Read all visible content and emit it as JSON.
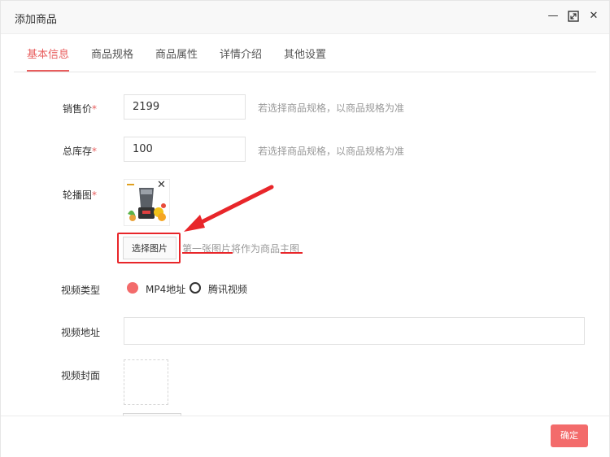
{
  "dialog": {
    "title": "添加商品",
    "controls": {
      "minimize": "—",
      "maximize": "⤢",
      "close": "✕"
    }
  },
  "tabs": [
    {
      "label": "基本信息",
      "active": true
    },
    {
      "label": "商品规格",
      "active": false
    },
    {
      "label": "商品属性",
      "active": false
    },
    {
      "label": "详情介绍",
      "active": false
    },
    {
      "label": "其他设置",
      "active": false
    }
  ],
  "form": {
    "price": {
      "label": "销售价",
      "required_mark": "*",
      "value": "2199",
      "hint": "若选择商品规格，以商品规格为准"
    },
    "stock": {
      "label": "总库存",
      "required_mark": "*",
      "value": "100",
      "hint": "若选择商品规格，以商品规格为准"
    },
    "carousel": {
      "label": "轮播图",
      "required_mark": "*",
      "remove_icon": "✕",
      "select_button": "选择图片",
      "hint": "第一张图片将作为商品主图"
    },
    "video_type": {
      "label": "视频类型",
      "options": [
        {
          "label": "MP4地址",
          "selected": true
        },
        {
          "label": "腾讯视频",
          "selected": false
        }
      ]
    },
    "video_url": {
      "label": "视频地址",
      "value": ""
    },
    "video_cover": {
      "label": "视频封面"
    }
  },
  "footer": {
    "confirm_label": "确定"
  },
  "colors": {
    "accent": "#e85d5d",
    "annotation": "#e8262a",
    "confirm_bg": "#f36b6b"
  }
}
